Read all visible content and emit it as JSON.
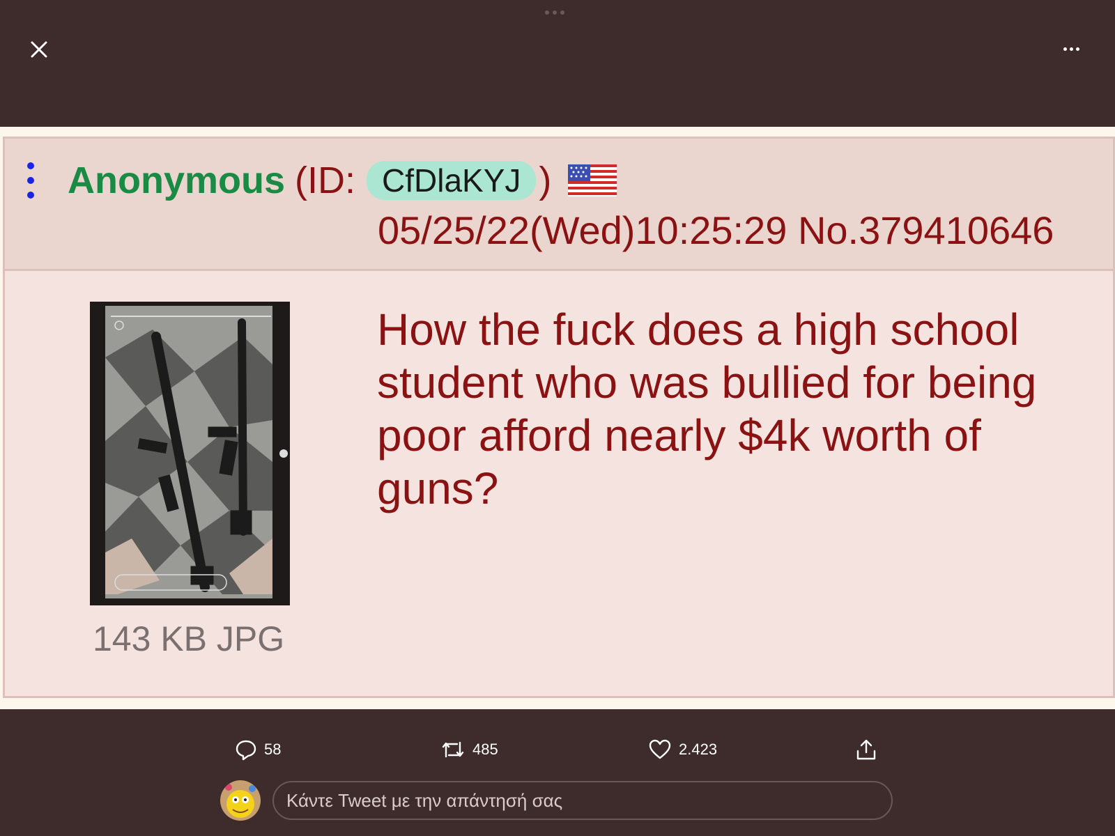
{
  "viewer": {
    "close_icon": "close-icon",
    "more_icon": "more-horizontal-icon"
  },
  "post": {
    "author": "Anonymous",
    "id_label": "(ID:",
    "id_value": "CfDlaKYJ",
    "id_close": ")",
    "flag": "us-flag-icon",
    "datetime": "05/25/22(Wed)10:25:29 No.379410646",
    "file_info": "143 KB JPG",
    "text": "How the fuck does a high school student who was bullied for being poor afford nearly $4k worth of guns?"
  },
  "actions": {
    "reply_count": "58",
    "retweet_count": "485",
    "like_count": "2.423"
  },
  "reply": {
    "placeholder": "Κάντε Tweet με την απάντησή σας"
  },
  "colors": {
    "background": "#3e2b2b",
    "post_bg": "#f4e3de",
    "header_bg": "#ead6cf",
    "name_green": "#1a8a45",
    "text_red": "#8a1212",
    "id_pill": "#abe6d3"
  }
}
